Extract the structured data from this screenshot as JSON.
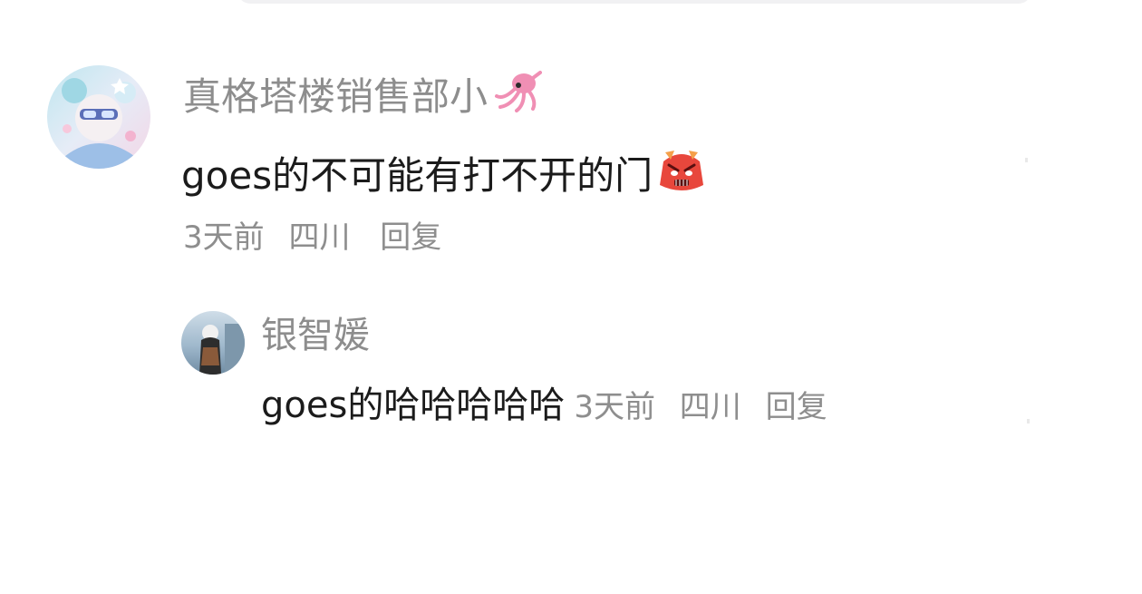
{
  "comments": [
    {
      "username": "真格塔楼销售部小",
      "username_icon": "squid-emoji-icon",
      "text": "goes的不可能有打不开的门",
      "text_icon": "angry-face-emoji-icon",
      "time": "3天前",
      "location": "四川",
      "reply_label": "回复",
      "replies": [
        {
          "username": "银智媛",
          "text": "goes的哈哈哈哈哈",
          "time": "3天前",
          "location": "四川",
          "reply_label": "回复"
        }
      ]
    }
  ],
  "colors": {
    "username": "#8d8d8d",
    "text": "#1b1b1b",
    "meta": "#8e8e8e",
    "background": "#ffffff"
  }
}
